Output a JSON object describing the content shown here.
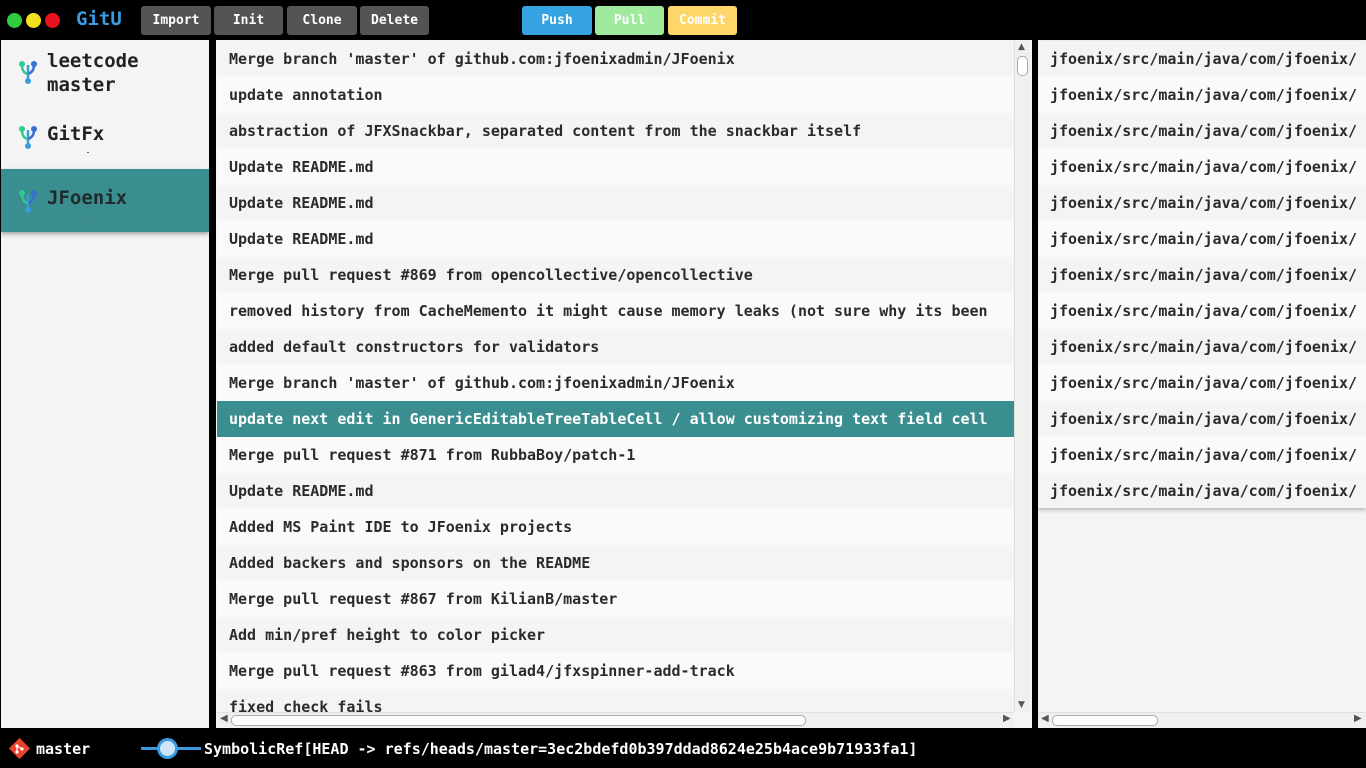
{
  "app": {
    "title": "GitU"
  },
  "toolbar": {
    "import_label": "Import",
    "init_label": "Init",
    "clone_label": "Clone",
    "delete_label": "Delete",
    "push_label": "Push",
    "pull_label": "Pull",
    "commit_label": "Commit"
  },
  "repos": [
    {
      "name": "leetcode",
      "branch": "master",
      "icon": "repo-fork-icon"
    },
    {
      "name": "GitFx",
      "icon": "repo-fork-icon"
    },
    {
      "name": "JFoenix",
      "icon": "repo-fork-icon",
      "selected": true
    }
  ],
  "commits": [
    "Merge branch 'master' of github.com:jfoenixadmin/JFoenix",
    "update annotation",
    "abstraction of JFXSnackbar, separated content from the snackbar itself",
    "Update README.md",
    "Update README.md",
    "Update README.md",
    "Merge pull request #869 from opencollective/opencollective",
    "removed history from CacheMemento it might cause memory leaks (not sure why its been",
    "added default constructors for validators",
    "Merge branch 'master' of github.com:jfoenixadmin/JFoenix",
    "update next edit in GenericEditableTreeTableCell / allow customizing text field cell",
    "Merge pull request #871 from RubbaBoy/patch-1",
    "Update README.md",
    "Added MS Paint IDE to JFoenix projects",
    "Added backers and sponsors on the README",
    "Merge pull request #867 from KilianB/master",
    "Add min/pref height to color picker",
    "Merge pull request #863 from gilad4/jfxspinner-add-track",
    "fixed check fails"
  ],
  "selected_commit_index": 10,
  "files": [
    "jfoenix/src/main/java/com/jfoenix/",
    "jfoenix/src/main/java/com/jfoenix/",
    "jfoenix/src/main/java/com/jfoenix/",
    "jfoenix/src/main/java/com/jfoenix/",
    "jfoenix/src/main/java/com/jfoenix/",
    "jfoenix/src/main/java/com/jfoenix/",
    "jfoenix/src/main/java/com/jfoenix/",
    "jfoenix/src/main/java/com/jfoenix/",
    "jfoenix/src/main/java/com/jfoenix/",
    "jfoenix/src/main/java/com/jfoenix/",
    "jfoenix/src/main/java/com/jfoenix/",
    "jfoenix/src/main/java/com/jfoenix/",
    "jfoenix/src/main/java/com/jfoenix/"
  ],
  "status": {
    "branch": "master",
    "head_ref": "SymbolicRef[HEAD -> refs/heads/master=3ec2bdefd0b397ddad8624e25b4ace9b71933fa1]"
  },
  "colors": {
    "accent": "#3a8e90",
    "push": "#35a2e2",
    "pull": "#9fea9d",
    "commit": "#fdd66a",
    "title": "#3a9be0"
  }
}
